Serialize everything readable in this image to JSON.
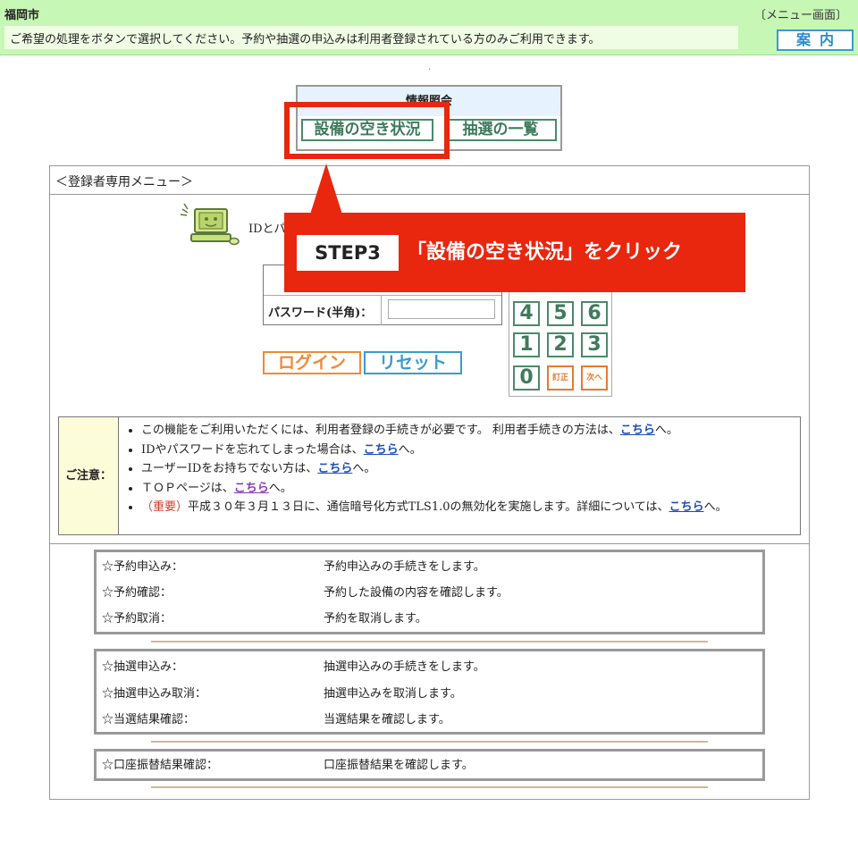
{
  "header": {
    "city": "福岡市",
    "screen_label": "〔メニュー画面〕",
    "instruction": "ご希望の処理をボタンで選択してください。予約や抽選の申込みは利用者登録されている方のみご利用できます。",
    "guide_label": "案内"
  },
  "info": {
    "title": "情報照会",
    "facility_label": "設備の空き状況",
    "lottery_label": "抽選の一覧"
  },
  "panel": {
    "title": "＜登録者専用メニュー＞"
  },
  "login": {
    "id_text": "IDとパ",
    "password_label": "パスワード(半角)：",
    "password_value": "",
    "login_label": "ログイン",
    "reset_label": "リセット"
  },
  "keypad": {
    "keys": [
      "4",
      "5",
      "6",
      "1",
      "2",
      "3",
      "0",
      "訂正",
      "次へ"
    ]
  },
  "callout": {
    "step": "STEP3",
    "text": "「設備の空き状況」をクリック"
  },
  "notice": {
    "label": "ご注意：",
    "items": [
      {
        "pre": "この機能をご利用いただくには、利用者登録の手続きが必要です。 利用者手続きの方法は、",
        "link": "こちら",
        "post": "へ。"
      },
      {
        "pre": "IDやパスワードを忘れてしまった場合は、",
        "link": "こちら",
        "post": "へ。"
      },
      {
        "pre": "ユーザーIDをお持ちでない方は、",
        "link": "こちら",
        "post": "へ。"
      },
      {
        "pre": "ＴＯＰページは、",
        "link": "こちら",
        "post": "へ。"
      },
      {
        "important": "（重要）",
        "pre": "平成３０年３月１３日に、通信暗号化方式TLS1.0の無効化を実施します。詳細については、",
        "link": "こちら",
        "post": "へ。"
      }
    ]
  },
  "menus": {
    "reservation": [
      {
        "label": "☆予約申込み：",
        "desc": "予約申込みの手続きをします。"
      },
      {
        "label": "☆予約確認：",
        "desc": "予約した設備の内容を確認します。"
      },
      {
        "label": "☆予約取消：",
        "desc": "予約を取消します。"
      }
    ],
    "lottery": [
      {
        "label": "☆抽選申込み：",
        "desc": "抽選申込みの手続きをします。"
      },
      {
        "label": "☆抽選申込み取消：",
        "desc": "抽選申込みを取消します。"
      },
      {
        "label": "☆当選結果確認：",
        "desc": "当選結果を確認します。"
      }
    ],
    "account": [
      {
        "label": "☆口座振替結果確認：",
        "desc": "口座振替結果を確認します。"
      }
    ]
  },
  "colors": {
    "header_bg": "#c6f7b4",
    "accent_red": "#e8270e",
    "button_green": "#3f7a5c",
    "button_orange": "#f08a3a",
    "button_blue": "#3a9bd0"
  }
}
